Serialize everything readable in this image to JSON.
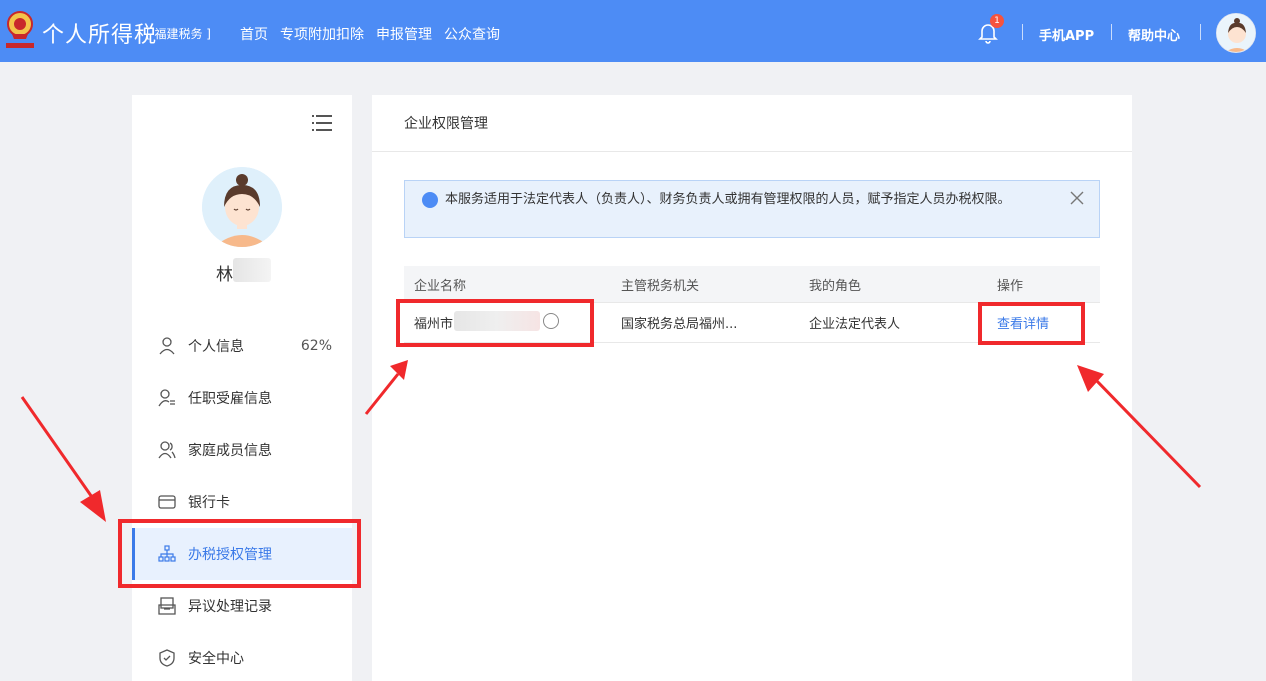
{
  "header": {
    "app_title": "个人所得税",
    "region": "[ 福建税务 ]",
    "nav": [
      "首页",
      "专项附加扣除",
      "申报管理",
      "公众查询"
    ],
    "notification_count": "1",
    "mobile_app": "手机APP",
    "help_center": "帮助中心"
  },
  "sidebar": {
    "user_name": "林",
    "items": [
      {
        "label": "个人信息",
        "icon": "person-icon",
        "extra": "62%"
      },
      {
        "label": "任职受雇信息",
        "icon": "employment-icon"
      },
      {
        "label": "家庭成员信息",
        "icon": "family-icon"
      },
      {
        "label": "银行卡",
        "icon": "bank-card-icon"
      },
      {
        "label": "办税授权管理",
        "icon": "org-tree-icon",
        "active": true
      },
      {
        "label": "异议处理记录",
        "icon": "dispute-icon"
      },
      {
        "label": "安全中心",
        "icon": "shield-icon"
      }
    ]
  },
  "main": {
    "title": "企业权限管理",
    "alert": "本服务适用于法定代表人（负责人）、财务负责人或拥有管理权限的人员，赋予指定人员办税权限。",
    "table": {
      "headers": [
        "企业名称",
        "主管税务机关",
        "我的角色",
        "操作"
      ],
      "rows": [
        {
          "company": "福州市",
          "authority": "国家税务总局福州...",
          "role": "企业法定代表人",
          "action": "查看详情"
        }
      ]
    }
  },
  "colors": {
    "topbar": "#4d8cf5",
    "accent": "#3b7ae8",
    "annotation": "#f0292c"
  }
}
